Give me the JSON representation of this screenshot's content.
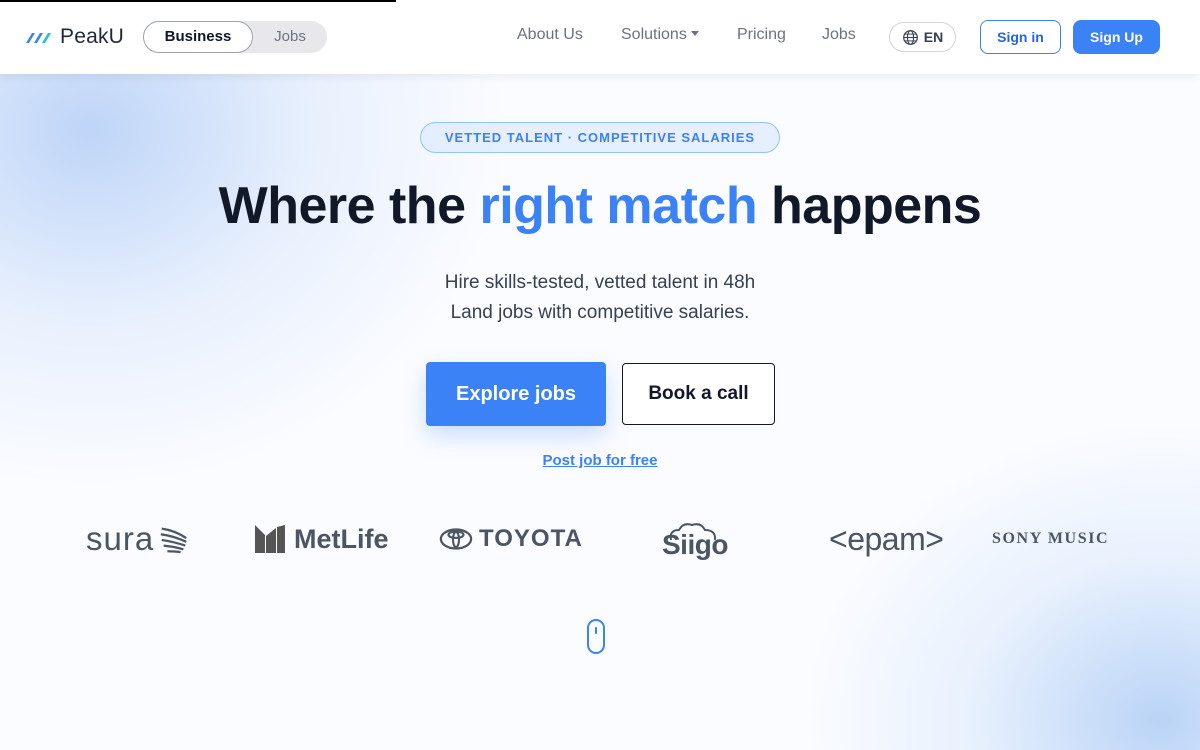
{
  "header": {
    "logo_text": "PeakU",
    "toggle": {
      "active": "Business",
      "inactive": "Jobs"
    },
    "nav": {
      "about": "About Us",
      "solutions": "Solutions",
      "pricing": "Pricing",
      "jobs": "Jobs"
    },
    "language": "EN",
    "sign_in": "Sign in",
    "sign_up": "Sign Up"
  },
  "hero": {
    "badge": "VETTED TALENT · COMPETITIVE SALARIES",
    "title_before": "Where the ",
    "title_highlight": "right match",
    "title_after": " happens",
    "subtitle_line1": "Hire skills-tested, vetted talent in 48h",
    "subtitle_line2": "Land jobs with competitive salaries.",
    "primary_cta": "Explore jobs",
    "secondary_cta": "Book a call",
    "post_job_link": "Post job for free"
  },
  "clients": {
    "sura": "sura",
    "metlife": "MetLife",
    "toyota": "TOYOTA",
    "siigo": "Siigo",
    "epam": "<epam>",
    "sony": "SONY MUSIC"
  },
  "colors": {
    "accent": "#3b82f6",
    "heading": "#111827",
    "muted": "#6b7280"
  }
}
